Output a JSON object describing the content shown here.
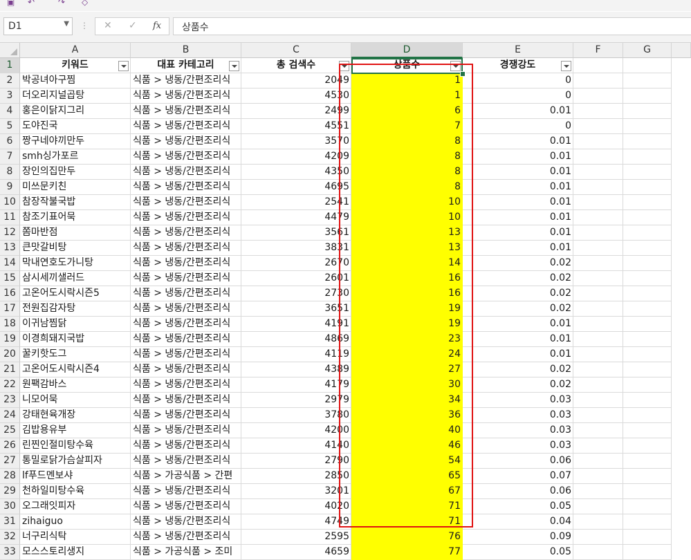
{
  "formula_bar": {
    "name_box": "D1",
    "fx_label": "fx",
    "content": "상품수"
  },
  "columns": [
    "A",
    "B",
    "C",
    "D",
    "E",
    "F",
    "G"
  ],
  "headers": [
    "키워드",
    "대표 카테고리",
    "총 검색수",
    "상품수",
    "경쟁강도"
  ],
  "colors": {
    "highlight": "#ffff00",
    "annotation_box": "#e01212",
    "selection": "#217346"
  },
  "rows": [
    {
      "n": "2",
      "keyword": "박공녀아구찜",
      "category": "식품 > 냉동/간편조리식",
      "searches": "2049",
      "products": "1",
      "competition": "0"
    },
    {
      "n": "3",
      "keyword": "더오리지널곱탕",
      "category": "식품 > 냉동/간편조리식",
      "searches": "4530",
      "products": "1",
      "competition": "0"
    },
    {
      "n": "4",
      "keyword": "홍은이닭지그리",
      "category": "식품 > 냉동/간편조리식",
      "searches": "2499",
      "products": "6",
      "competition": "0.01"
    },
    {
      "n": "5",
      "keyword": "도야진국",
      "category": "식품 > 냉동/간편조리식",
      "searches": "4551",
      "products": "7",
      "competition": "0"
    },
    {
      "n": "6",
      "keyword": "짱구네야끼만두",
      "category": "식품 > 냉동/간편조리식",
      "searches": "3570",
      "products": "8",
      "competition": "0.01"
    },
    {
      "n": "7",
      "keyword": "smh싱가포르",
      "category": "식품 > 냉동/간편조리식",
      "searches": "4209",
      "products": "8",
      "competition": "0.01"
    },
    {
      "n": "8",
      "keyword": "장인의집만두",
      "category": "식품 > 냉동/간편조리식",
      "searches": "4350",
      "products": "8",
      "competition": "0.01"
    },
    {
      "n": "9",
      "keyword": "미쓰문키친",
      "category": "식품 > 냉동/간편조리식",
      "searches": "4695",
      "products": "8",
      "competition": "0.01"
    },
    {
      "n": "10",
      "keyword": "참장작불국밥",
      "category": "식품 > 냉동/간편조리식",
      "searches": "2541",
      "products": "10",
      "competition": "0.01"
    },
    {
      "n": "11",
      "keyword": "참조기표어묵",
      "category": "식품 > 냉동/간편조리식",
      "searches": "4479",
      "products": "10",
      "competition": "0.01"
    },
    {
      "n": "12",
      "keyword": "쫌마반점",
      "category": "식품 > 냉동/간편조리식",
      "searches": "3561",
      "products": "13",
      "competition": "0.01"
    },
    {
      "n": "13",
      "keyword": "큰맛갈비탕",
      "category": "식품 > 냉동/간편조리식",
      "searches": "3831",
      "products": "13",
      "competition": "0.01"
    },
    {
      "n": "14",
      "keyword": "막내연호도가니탕",
      "category": "식품 > 냉동/간편조리식",
      "searches": "2670",
      "products": "14",
      "competition": "0.02"
    },
    {
      "n": "15",
      "keyword": "삼시세끼샐러드",
      "category": "식품 > 냉동/간편조리식",
      "searches": "2601",
      "products": "16",
      "competition": "0.02"
    },
    {
      "n": "16",
      "keyword": "고온어도시락시즌5",
      "category": "식품 > 냉동/간편조리식",
      "searches": "2730",
      "products": "16",
      "competition": "0.02"
    },
    {
      "n": "17",
      "keyword": "전원집감자탕",
      "category": "식품 > 냉동/간편조리식",
      "searches": "3651",
      "products": "19",
      "competition": "0.02"
    },
    {
      "n": "18",
      "keyword": "이귀남찜닭",
      "category": "식품 > 냉동/간편조리식",
      "searches": "4191",
      "products": "19",
      "competition": "0.01"
    },
    {
      "n": "19",
      "keyword": "이경희돼지국밥",
      "category": "식품 > 냉동/간편조리식",
      "searches": "4869",
      "products": "23",
      "competition": "0.01"
    },
    {
      "n": "20",
      "keyword": "꿀키핫도그",
      "category": "식품 > 냉동/간편조리식",
      "searches": "4119",
      "products": "24",
      "competition": "0.01"
    },
    {
      "n": "21",
      "keyword": "고온어도시락시즌4",
      "category": "식품 > 냉동/간편조리식",
      "searches": "4389",
      "products": "27",
      "competition": "0.02"
    },
    {
      "n": "22",
      "keyword": "원팩감바스",
      "category": "식품 > 냉동/간편조리식",
      "searches": "4179",
      "products": "30",
      "competition": "0.02"
    },
    {
      "n": "23",
      "keyword": "니모어묵",
      "category": "식품 > 냉동/간편조리식",
      "searches": "2979",
      "products": "34",
      "competition": "0.03"
    },
    {
      "n": "24",
      "keyword": "강태현육개장",
      "category": "식품 > 냉동/간편조리식",
      "searches": "3780",
      "products": "36",
      "competition": "0.03"
    },
    {
      "n": "25",
      "keyword": "김밥용유부",
      "category": "식품 > 냉동/간편조리식",
      "searches": "4200",
      "products": "40",
      "competition": "0.03"
    },
    {
      "n": "26",
      "keyword": "린찐인절미탕수육",
      "category": "식품 > 냉동/간편조리식",
      "searches": "4140",
      "products": "46",
      "competition": "0.03"
    },
    {
      "n": "27",
      "keyword": "통밀로닭가슴살피자",
      "category": "식품 > 냉동/간편조리식",
      "searches": "2790",
      "products": "54",
      "competition": "0.06"
    },
    {
      "n": "28",
      "keyword": "lf푸드멘보샤",
      "category": "식품 > 가공식품 > 간편",
      "searches": "2850",
      "products": "65",
      "competition": "0.07"
    },
    {
      "n": "29",
      "keyword": "천하일미탕수육",
      "category": "식품 > 냉동/간편조리식",
      "searches": "3201",
      "products": "67",
      "competition": "0.06"
    },
    {
      "n": "30",
      "keyword": "오그래잇피자",
      "category": "식품 > 냉동/간편조리식",
      "searches": "4020",
      "products": "71",
      "competition": "0.05"
    },
    {
      "n": "31",
      "keyword": "zihaiguo",
      "category": "식품 > 냉동/간편조리식",
      "searches": "4749",
      "products": "71",
      "competition": "0.04"
    },
    {
      "n": "32",
      "keyword": "너구리식탁",
      "category": "식품 > 냉동/간편조리식",
      "searches": "2595",
      "products": "76",
      "competition": "0.09"
    },
    {
      "n": "33",
      "keyword": "모스스토리생지",
      "category": "식품 > 가공식품 > 조미",
      "searches": "4659",
      "products": "77",
      "competition": "0.05"
    }
  ]
}
